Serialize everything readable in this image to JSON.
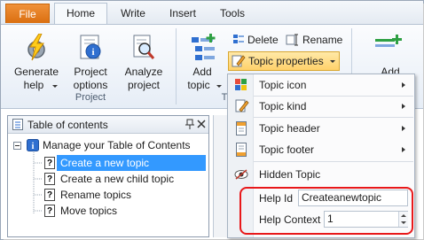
{
  "tabs": [
    "File",
    "Home",
    "Write",
    "Insert",
    "Tools"
  ],
  "ribbon": {
    "generate": {
      "label1": "Generate",
      "label2": "help"
    },
    "project_options": {
      "label1": "Project",
      "label2": "options"
    },
    "analyze": {
      "label1": "Analyze",
      "label2": "project"
    },
    "add_topic": {
      "label1": "Add",
      "label2": "topic"
    },
    "delete_label": "Delete",
    "rename_label": "Rename",
    "topic_properties_label": "Topic properties",
    "add_label": "Add",
    "group_project": "Project",
    "group_t_partial": "T"
  },
  "toc": {
    "title": "Table of contents",
    "root": "Manage your Table of Contents",
    "items": [
      "Create a new topic",
      "Create a new child topic",
      "Rename topics",
      "Move topics"
    ]
  },
  "menu": {
    "items": [
      "Topic icon",
      "Topic kind",
      "Topic header",
      "Topic footer",
      "Hidden Topic"
    ],
    "help_id_label": "Help Id",
    "help_id_value": "Createanewtopic",
    "help_context_label": "Help Context",
    "help_context_value": "1"
  },
  "colors": {
    "file_tab": "#e07a1e",
    "selection": "#3399ff",
    "highlight_box": "#e8181a"
  }
}
